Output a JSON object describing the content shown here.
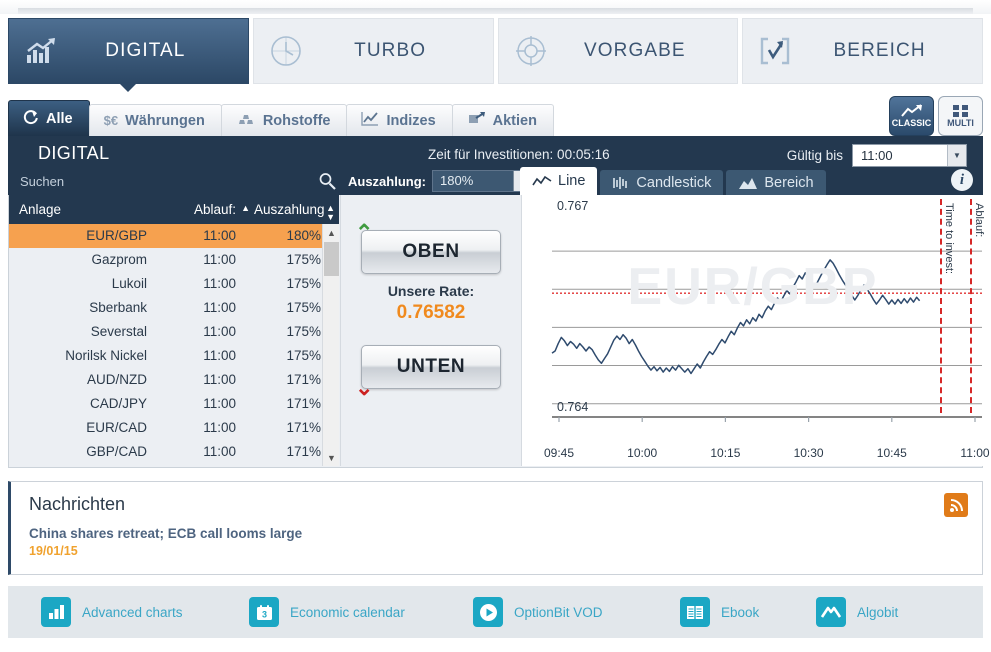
{
  "nav_tabs": [
    {
      "label": "DIGITAL",
      "icon": "bar-chart-arrow-icon",
      "active": true
    },
    {
      "label": "TURBO",
      "icon": "clock-icon",
      "active": false
    },
    {
      "label": "VORGABE",
      "icon": "target-icon",
      "active": false
    },
    {
      "label": "BEREICH",
      "icon": "bracket-check-arrow-icon",
      "active": false
    }
  ],
  "category_tabs": [
    {
      "label": "Alle",
      "icon": "refresh-icon",
      "active": true
    },
    {
      "label": "Währungen",
      "icon": "currency-icon",
      "active": false
    },
    {
      "label": "Rohstoffe",
      "icon": "gold-bars-icon",
      "active": false
    },
    {
      "label": "Indizes",
      "icon": "line-chart-icon",
      "active": false
    },
    {
      "label": "Aktien",
      "icon": "stocks-icon",
      "active": false
    }
  ],
  "view_toggle": {
    "classic_label": "CLASSIC",
    "multi_label": "MULTI",
    "selected": "CLASSIC"
  },
  "panel": {
    "title": "DIGITAL",
    "invest_time_label": "Zeit für Investitionen: 00:05:16",
    "valid_until_label": "Gültig bis",
    "valid_until_value": "11:00",
    "search_placeholder": "Suchen",
    "search_value": "",
    "payout_label": "Auszahlung:",
    "payout_value": "180%",
    "info_icon": "info-icon"
  },
  "chart_tabs": [
    {
      "label": "Line",
      "icon": "line-chart-icon",
      "active": true
    },
    {
      "label": "Candlestick",
      "icon": "candlestick-icon",
      "active": false
    },
    {
      "label": "Bereich",
      "icon": "area-chart-icon",
      "active": false
    }
  ],
  "assets_table": {
    "headers": [
      "Anlage",
      "Ablauf:",
      "Auszahlung"
    ],
    "sort_column": "Ablauf:",
    "sort_direction": "asc",
    "rows": [
      {
        "name": "EUR/GBP",
        "expiry": "11:00",
        "payout": "180%",
        "selected": true
      },
      {
        "name": "Gazprom",
        "expiry": "11:00",
        "payout": "175%",
        "selected": false
      },
      {
        "name": "Lukoil",
        "expiry": "11:00",
        "payout": "175%",
        "selected": false
      },
      {
        "name": "Sberbank",
        "expiry": "11:00",
        "payout": "175%",
        "selected": false
      },
      {
        "name": "Severstal",
        "expiry": "11:00",
        "payout": "175%",
        "selected": false
      },
      {
        "name": "Norilsk Nickel",
        "expiry": "11:00",
        "payout": "175%",
        "selected": false
      },
      {
        "name": "AUD/NZD",
        "expiry": "11:00",
        "payout": "171%",
        "selected": false
      },
      {
        "name": "CAD/JPY",
        "expiry": "11:00",
        "payout": "171%",
        "selected": false
      },
      {
        "name": "EUR/CAD",
        "expiry": "11:00",
        "payout": "171%",
        "selected": false
      },
      {
        "name": "GBP/CAD",
        "expiry": "11:00",
        "payout": "171%",
        "selected": false
      }
    ]
  },
  "trade_panel": {
    "up_label": "OBEN",
    "down_label": "UNTEN",
    "rate_label": "Unsere Rate:",
    "rate_value": "0.76582",
    "rate_color": "#f08a1e"
  },
  "chart_data": {
    "type": "line",
    "title": "EUR/GBP",
    "watermark": "EUR/GBP",
    "xlabel": "",
    "ylabel": "",
    "ylim": [
      0.764,
      0.767
    ],
    "y_tick_labels": [
      "0.767",
      "0.764"
    ],
    "x_tick_labels": [
      "09:45",
      "10:00",
      "10:15",
      "10:30",
      "10:45",
      "11:00"
    ],
    "grid": true,
    "gridlines": 5,
    "legend": "none",
    "current_rate": 0.76582,
    "rate_line_color": "#e03030",
    "line_color": "#2f4b6e",
    "annotations": [
      {
        "label": "Time to invest:",
        "x_time": "10:54",
        "style": "dashed-vertical",
        "color": "#d62828"
      },
      {
        "label": "Ablauf:",
        "x_time": "11:00",
        "style": "dashed-vertical",
        "color": "#d62828"
      }
    ],
    "x": [
      0,
      1,
      2,
      3,
      4,
      5,
      6,
      7,
      8,
      9,
      10,
      11,
      12,
      13,
      14,
      15,
      16,
      17,
      18,
      19,
      20,
      21,
      22,
      23,
      24,
      25,
      26,
      27,
      28,
      29,
      30,
      31,
      32,
      33,
      34,
      35,
      36,
      37,
      38,
      39,
      40,
      41,
      42,
      43,
      44,
      45,
      46,
      47,
      48,
      49,
      50,
      51,
      52,
      53,
      54,
      55,
      56,
      57,
      58,
      59,
      60,
      61,
      62,
      63,
      64,
      65,
      66,
      67,
      68,
      69,
      70,
      71,
      72,
      73,
      74,
      75,
      76,
      77,
      78,
      79,
      80,
      81,
      82,
      83,
      84,
      85,
      86,
      87,
      88,
      89,
      90,
      91,
      92,
      93,
      94,
      95,
      96,
      97,
      98,
      99,
      100,
      101,
      102,
      103,
      104,
      105,
      106,
      107,
      108,
      109,
      110,
      111,
      112,
      113,
      114,
      115,
      116,
      117,
      118,
      119
    ],
    "values": [
      0.76494,
      0.76497,
      0.76508,
      0.76517,
      0.76512,
      0.76505,
      0.76511,
      0.76507,
      0.76501,
      0.76508,
      0.76503,
      0.76497,
      0.76503,
      0.76499,
      0.76491,
      0.76484,
      0.76479,
      0.76486,
      0.76493,
      0.76503,
      0.76513,
      0.76519,
      0.76514,
      0.76521,
      0.76516,
      0.76508,
      0.76514,
      0.76506,
      0.76497,
      0.76489,
      0.76482,
      0.76475,
      0.76469,
      0.76474,
      0.76468,
      0.76473,
      0.76466,
      0.76472,
      0.76467,
      0.76474,
      0.76469,
      0.76476,
      0.76471,
      0.76466,
      0.76471,
      0.76464,
      0.76471,
      0.76478,
      0.76472,
      0.76481,
      0.76489,
      0.76496,
      0.76492,
      0.76499,
      0.76507,
      0.76514,
      0.76509,
      0.76518,
      0.76526,
      0.76521,
      0.76531,
      0.76539,
      0.76534,
      0.76543,
      0.76537,
      0.76546,
      0.76541,
      0.76551,
      0.76546,
      0.76556,
      0.76563,
      0.76558,
      0.76567,
      0.76575,
      0.76569,
      0.76578,
      0.76586,
      0.76581,
      0.76591,
      0.76599,
      0.76608,
      0.76603,
      0.76612,
      0.76606,
      0.76598,
      0.76591,
      0.76599,
      0.76608,
      0.76616,
      0.76624,
      0.76631,
      0.76626,
      0.76618,
      0.76609,
      0.76601,
      0.76594,
      0.76587,
      0.76579,
      0.76572,
      0.76579,
      0.76587,
      0.76594,
      0.76588,
      0.76581,
      0.76573,
      0.76566,
      0.76572,
      0.76579,
      0.76573,
      0.76566,
      0.76572,
      0.76566,
      0.76573,
      0.76567,
      0.76574,
      0.76568,
      0.76575,
      0.76569,
      0.76576,
      0.76571
    ]
  },
  "news": {
    "section_title": "Nachrichten",
    "headline": "China shares retreat; ECB call looms large",
    "date": "19/01/15",
    "rss_icon": "rss-icon"
  },
  "footer_links": [
    {
      "label": "Advanced charts",
      "icon": "bar-chart-icon"
    },
    {
      "label": "Economic calendar",
      "icon": "calendar-icon"
    },
    {
      "label": "OptionBit VOD",
      "icon": "play-icon"
    },
    {
      "label": "Ebook",
      "icon": "book-icon"
    },
    {
      "label": "Algobit",
      "icon": "mountain-icon"
    }
  ]
}
